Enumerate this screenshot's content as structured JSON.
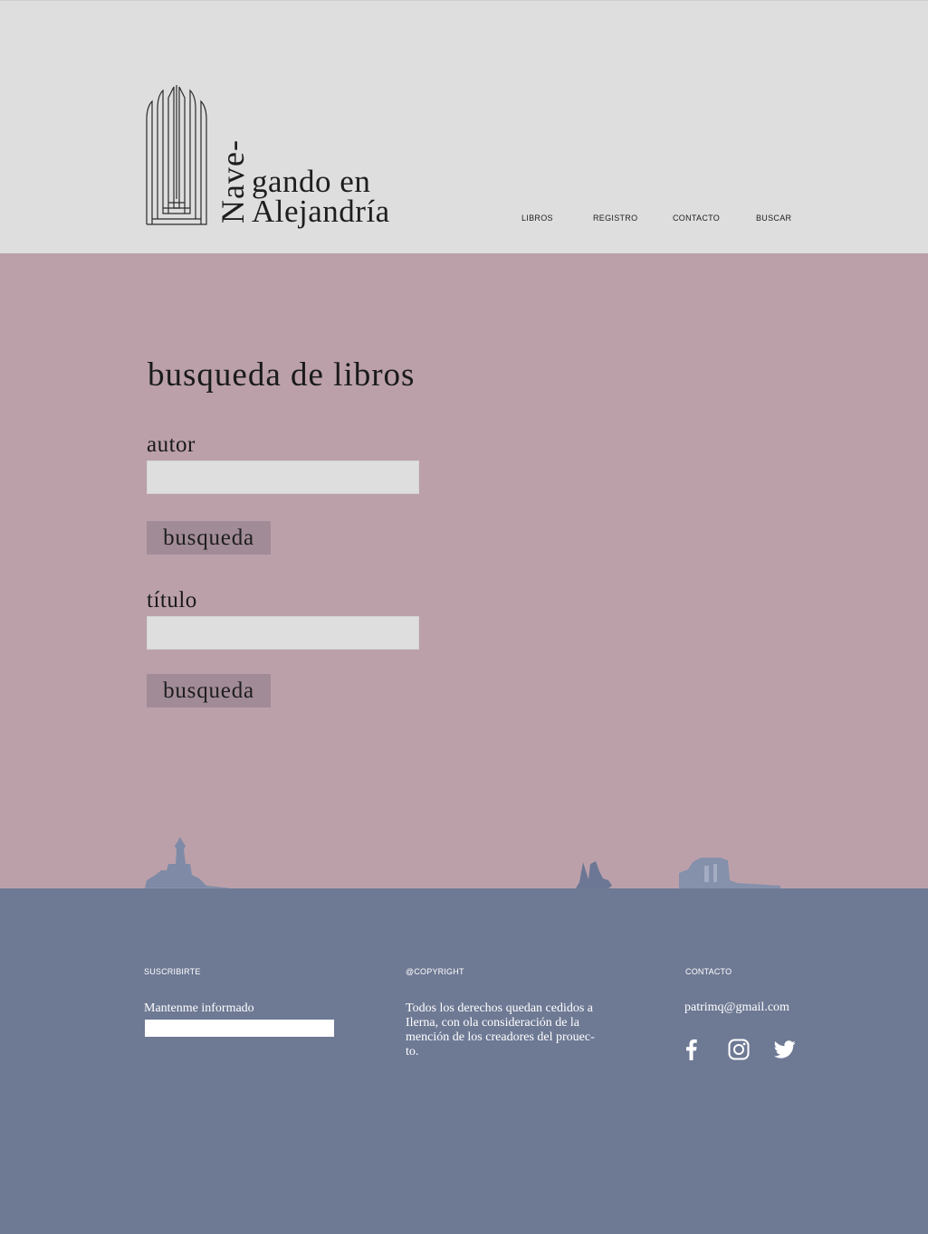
{
  "brand": {
    "vertical": "Nave-",
    "line1": "gando en",
    "line2": "Alejandría"
  },
  "nav": {
    "items": [
      "LIBROS",
      "REGISTRO",
      "CONTACTO",
      "BUSCAR"
    ]
  },
  "search": {
    "title": "busqueda de libros",
    "author_label": "autor",
    "author_value": "",
    "author_button": "busqueda",
    "title_label": "título",
    "title_value": "",
    "title_button": "busqueda"
  },
  "footer": {
    "subscribe_heading": "SUSCRIBIRTE",
    "subscribe_text": "Mantenme informado",
    "subscribe_value": "",
    "copyright_heading": "@COPYRIGHT",
    "copyright_lines": [
      "Todos los derechos quedan cedidos a",
      "Ilerna, con ola consideración de la",
      "mención de los creadores del prouec-",
      "to."
    ],
    "contact_heading": "CONTACTO",
    "contact_email": "patrimq@gmail.com",
    "social_icons": [
      "facebook-icon",
      "instagram-icon",
      "twitter-icon"
    ]
  },
  "colors": {
    "header_bg": "#dedede",
    "main_bg": "#bba0aa",
    "button_bg": "#a18b96",
    "footer_bg": "#6e7994",
    "silhouette": "#7f8aa6"
  }
}
